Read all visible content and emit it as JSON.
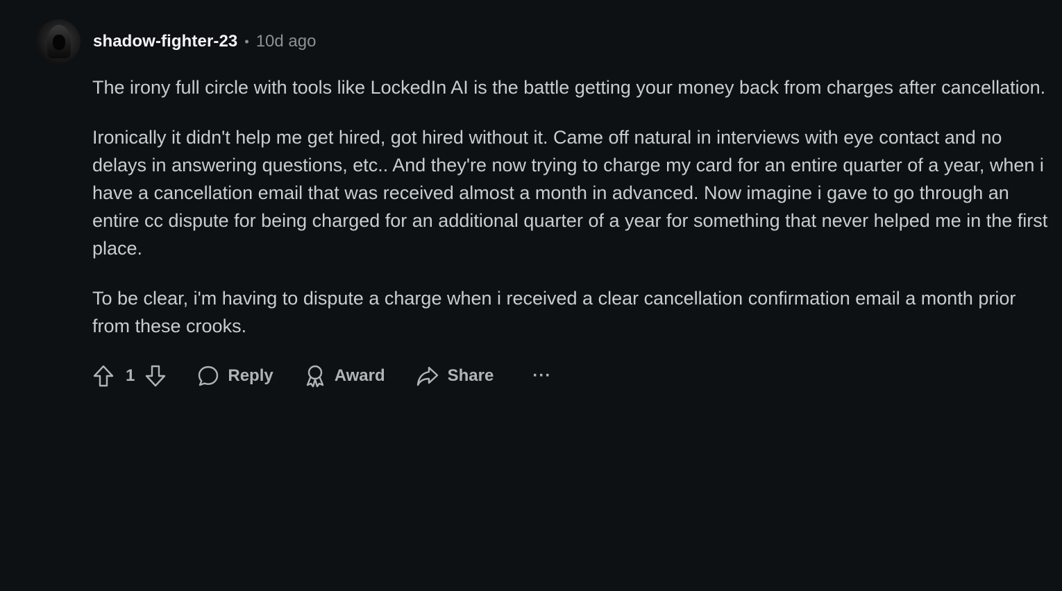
{
  "comment": {
    "author": "shadow-fighter-23",
    "separator": "•",
    "time_ago": "10d ago",
    "paragraphs": [
      "The irony full circle with tools like LockedIn AI is the battle getting your money back from charges after cancellation.",
      "Ironically it didn't help me get hired, got hired without it. Came off natural in interviews with eye contact and no delays in answering questions, etc.. And they're now trying to charge my card for an entire quarter of a year, when i have a cancellation email that was received almost a month in advanced. Now imagine i gave to go through an entire cc dispute for being charged for an additional quarter of a year for something that never helped me in the first place.",
      "To be clear, i'm having to dispute a charge when i received a clear cancellation confirmation email a month prior from these crooks."
    ],
    "vote_count": "1",
    "actions": {
      "reply_label": "Reply",
      "award_label": "Award",
      "share_label": "Share",
      "more_label": "···"
    }
  },
  "icons": {
    "upvote": "upvote-arrow-icon",
    "downvote": "downvote-arrow-icon",
    "reply": "speech-bubble-icon",
    "award": "award-ribbon-icon",
    "share": "share-arrow-icon",
    "more": "ellipsis-icon"
  },
  "colors": {
    "background": "#0e1113",
    "text": "#c7cdd1",
    "author": "#f2f4f5",
    "muted": "#8a9196"
  }
}
